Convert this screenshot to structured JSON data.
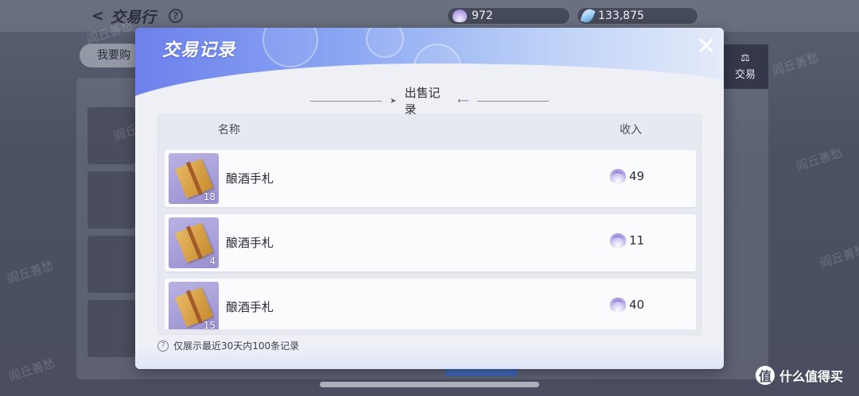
{
  "background": {
    "title": "交易行",
    "help_glyph": "?",
    "currencies": [
      {
        "icon": "shell-currency-icon",
        "value": "972"
      },
      {
        "icon": "feather-currency-icon",
        "value": "133,875"
      }
    ],
    "left_tab_label": "我要购",
    "right_tab_label": "交易",
    "watermark": "阎丘善愁"
  },
  "dialog": {
    "title": "交易记录",
    "close_glyph": "✕",
    "section_title": "出售记录",
    "columns": {
      "name": "名称",
      "income": "收入"
    },
    "rows": [
      {
        "name": "酿酒手札",
        "count": "18",
        "income": "49"
      },
      {
        "name": "酿酒手札",
        "count": "4",
        "income": "11"
      },
      {
        "name": "酿酒手札",
        "count": "15",
        "income": "40"
      }
    ],
    "footer_note": "仅展示最近30天内100条记录"
  },
  "brand": {
    "logo_glyph": "值",
    "text": "什么值得买"
  },
  "colors": {
    "header_gradient_start": "#6d80ec",
    "panel_bg": "#eef0f6",
    "item_icon_bg": "#9a90d2"
  }
}
